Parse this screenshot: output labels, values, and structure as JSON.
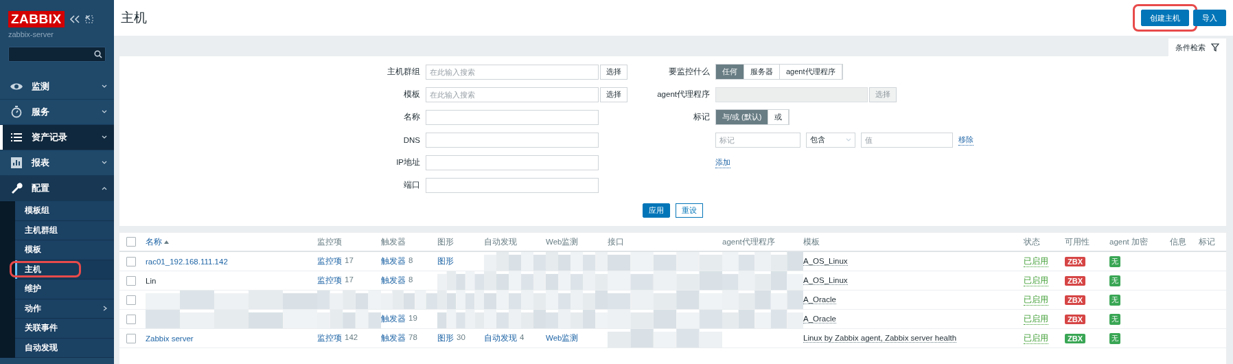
{
  "sidebar": {
    "logo": "ZABBIX",
    "server": "zabbix-server",
    "menu": [
      {
        "label": "监测",
        "expanded": false,
        "hovered": false
      },
      {
        "label": "服务",
        "expanded": false,
        "hovered": false
      },
      {
        "label": "资产记录",
        "expanded": false,
        "hovered": true
      },
      {
        "label": "报表",
        "expanded": false,
        "hovered": false
      },
      {
        "label": "配置",
        "expanded": true,
        "hovered": false,
        "children": [
          {
            "label": "模板组",
            "selected": false,
            "has_submenu": false,
            "highlighted": false
          },
          {
            "label": "主机群组",
            "selected": false,
            "has_submenu": false,
            "highlighted": false
          },
          {
            "label": "模板",
            "selected": false,
            "has_submenu": false,
            "highlighted": false
          },
          {
            "label": "主机",
            "selected": true,
            "has_submenu": false,
            "highlighted": true
          },
          {
            "label": "维护",
            "selected": false,
            "has_submenu": false,
            "highlighted": false
          },
          {
            "label": "动作",
            "selected": false,
            "has_submenu": true,
            "highlighted": false
          },
          {
            "label": "关联事件",
            "selected": false,
            "has_submenu": false,
            "highlighted": false
          },
          {
            "label": "自动发现",
            "selected": false,
            "has_submenu": false,
            "highlighted": false
          }
        ]
      }
    ]
  },
  "header": {
    "title": "主机",
    "buttons": [
      {
        "label": "创建主机",
        "highlighted": true
      },
      {
        "label": "导入"
      }
    ]
  },
  "filter": {
    "tab": "条件检索",
    "left_fields": [
      {
        "label": "主机群组",
        "kind": "multiselect",
        "placeholder": "在此输入搜索",
        "button": "选择"
      },
      {
        "label": "模板",
        "kind": "multiselect",
        "placeholder": "在此输入搜索",
        "button": "选择"
      },
      {
        "label": "名称",
        "kind": "text"
      },
      {
        "label": "DNS",
        "kind": "text"
      },
      {
        "label": "IP地址",
        "kind": "text"
      },
      {
        "label": "端口",
        "kind": "text"
      }
    ],
    "monitored_by": {
      "label": "要监控什么",
      "options": [
        {
          "label": "任何",
          "selected": true
        },
        {
          "label": "服务器",
          "selected": false
        },
        {
          "label": "agent代理程序",
          "selected": false
        }
      ]
    },
    "proxy": {
      "label": "agent代理程序",
      "disabled": true,
      "button": "选择"
    },
    "tags": {
      "label": "标记",
      "operators": [
        {
          "label": "与/或 (默认)",
          "selected": true
        },
        {
          "label": "或",
          "selected": false
        }
      ],
      "rows": [
        {
          "tag_placeholder": "标记",
          "operator": "包含",
          "value_placeholder": "值",
          "remove": "移除"
        }
      ],
      "add": "添加"
    },
    "actions": [
      {
        "label": "应用",
        "primary": true
      },
      {
        "label": "重设",
        "primary": false
      }
    ]
  },
  "table": {
    "select_all_checked": false,
    "columns": [
      {
        "label": "名称",
        "sorted": true
      },
      {
        "label": "监控项",
        "sorted": false
      },
      {
        "label": "触发器",
        "sorted": false
      },
      {
        "label": "图形",
        "sorted": false
      },
      {
        "label": "自动发现",
        "sorted": false
      },
      {
        "label": "Web监测",
        "sorted": false
      },
      {
        "label": "接口",
        "sorted": false
      },
      {
        "label": "agent代理程序",
        "sorted": false
      },
      {
        "label": "模板",
        "sorted": false
      },
      {
        "label": "状态",
        "sorted": false
      },
      {
        "label": "可用性",
        "sorted": false
      },
      {
        "label": "agent 加密",
        "sorted": false
      },
      {
        "label": "信息",
        "sorted": false
      },
      {
        "label": "标记",
        "sorted": false
      }
    ],
    "rows": [
      {
        "checked": false,
        "cells": [
          {
            "kind": "link",
            "text": "rac01_192.168.111.142"
          },
          {
            "kind": "count",
            "text": "监控项",
            "count": "17"
          },
          {
            "kind": "count",
            "text": "触发器",
            "count": "8"
          },
          {
            "kind": "link",
            "text": "图形"
          },
          {
            "kind": "blurred"
          },
          {
            "kind": "blurred"
          },
          {
            "kind": "blurred"
          },
          {
            "kind": "blurred"
          }
        ],
        "template": "A_OS_Linux",
        "status": "已启用",
        "availability": {
          "label": "ZBX",
          "color": "#d64545"
        },
        "encryption": "无"
      },
      {
        "checked": false,
        "cells": [
          {
            "kind": "plain",
            "text": "Lin"
          },
          {
            "kind": "count",
            "text": "监控项",
            "count": "17"
          },
          {
            "kind": "count",
            "text": "触发器",
            "count": "8"
          },
          {
            "kind": "blurred"
          },
          {
            "kind": "blurred"
          },
          {
            "kind": "blurred"
          },
          {
            "kind": "blurred"
          },
          {
            "kind": "blurred"
          }
        ],
        "template": "A_OS_Linux",
        "status": "已启用",
        "availability": {
          "label": "ZBX",
          "color": "#d64545"
        },
        "encryption": "无"
      },
      {
        "checked": false,
        "cells": [
          {
            "kind": "blurred"
          },
          {
            "kind": "blurred"
          },
          {
            "kind": "blurred"
          },
          {
            "kind": "blurred"
          },
          {
            "kind": "blurred"
          },
          {
            "kind": "blurred"
          },
          {
            "kind": "blurred"
          },
          {
            "kind": "blurred"
          }
        ],
        "template": "A_Oracle",
        "status": "已启用",
        "availability": {
          "label": "ZBX",
          "color": "#d64545"
        },
        "encryption": "无"
      },
      {
        "checked": false,
        "cells": [
          {
            "kind": "blurred"
          },
          {
            "kind": "blurred"
          },
          {
            "kind": "count",
            "text": "触发器",
            "count": "19"
          },
          {
            "kind": "blurred"
          },
          {
            "kind": "blurred"
          },
          {
            "kind": "blurred"
          },
          {
            "kind": "blurred"
          },
          {
            "kind": "blurred"
          }
        ],
        "template": "A_Oracle",
        "status": "已启用",
        "availability": {
          "label": "ZBX",
          "color": "#d64545"
        },
        "encryption": "无"
      },
      {
        "checked": false,
        "cells": [
          {
            "kind": "link",
            "text": "Zabbix server"
          },
          {
            "kind": "count",
            "text": "监控项",
            "count": "142"
          },
          {
            "kind": "count",
            "text": "触发器",
            "count": "78"
          },
          {
            "kind": "count",
            "text": "图形",
            "count": "30"
          },
          {
            "kind": "count",
            "text": "自动发现",
            "count": "4"
          },
          {
            "kind": "link",
            "text": "Web监测"
          },
          {
            "kind": "blurred"
          },
          {
            "kind": "empty"
          }
        ],
        "template": "Linux by Zabbix agent, Zabbix server health",
        "status": "已启用",
        "availability": {
          "label": "ZBX",
          "color": "#3aa655"
        },
        "encryption": "无"
      }
    ]
  }
}
